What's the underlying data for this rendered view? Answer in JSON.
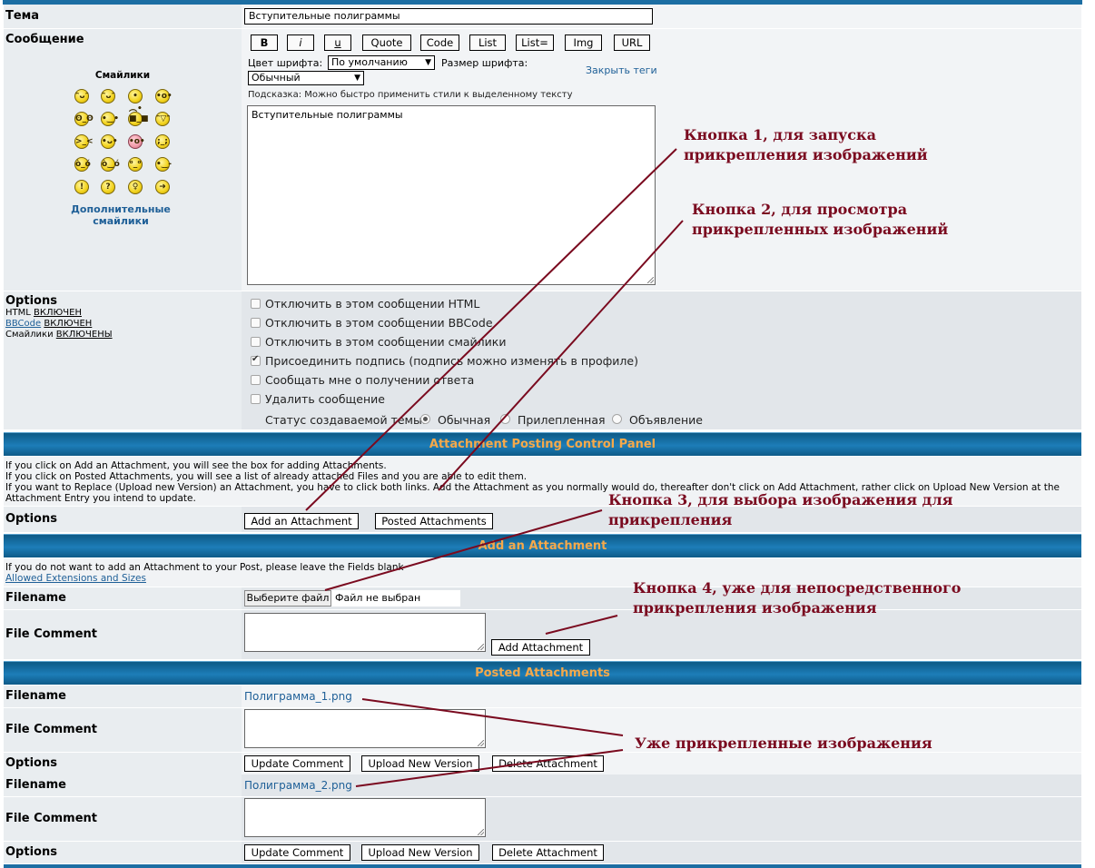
{
  "form": {
    "subject_label": "Тема",
    "subject_value": "Вступительные полиграммы",
    "message_label": "Сообщение",
    "smilies_title": "Смайлики",
    "more_smilies": "Дополнительные смайлики",
    "bbcode_buttons": [
      "B",
      "i",
      "u",
      "Quote",
      "Code",
      "List",
      "List=",
      "Img",
      "URL"
    ],
    "font_color_label": "Цвет шрифта:",
    "font_color_value": "По умолчанию",
    "font_size_label": "Размер шрифта:",
    "font_size_value": "Обычный",
    "close_tags": "Закрыть теги",
    "hint": "Подсказка: Можно быстро применить стили к выделенному тексту",
    "message_text": "Вступительные полиграммы"
  },
  "options": {
    "label": "Options",
    "html_line": {
      "name": "HTML",
      "state": "ВКЛЮЧЕН"
    },
    "bbcode_line": {
      "name": "BBCode",
      "state": "ВКЛЮЧЕН"
    },
    "smilies_line": {
      "name": "Смайлики",
      "state": "ВКЛЮЧЕНЫ"
    },
    "checkboxes": [
      {
        "label": "Отключить в этом сообщении HTML",
        "checked": false
      },
      {
        "label": "Отключить в этом сообщении BBCode",
        "checked": false
      },
      {
        "label": "Отключить в этом сообщении смайлики",
        "checked": false
      },
      {
        "label": "Присоединить подпись (подпись можно изменять в профиле)",
        "checked": true
      },
      {
        "label": "Сообщать мне о получении ответа",
        "checked": false
      },
      {
        "label": "Удалить сообщение",
        "checked": false
      }
    ],
    "topic_status_label": "Статус создаваемой темы:",
    "topic_status_options": [
      {
        "label": "Обычная",
        "selected": true
      },
      {
        "label": "Прилепленная",
        "selected": false
      },
      {
        "label": "Объявление",
        "selected": false
      }
    ]
  },
  "attach_panel": {
    "title": "Attachment Posting Control Panel",
    "lines": [
      "If you click on Add an Attachment, you will see the box for adding Attachments.",
      "If you click on Posted Attachments, you will see a list of already attached Files and you are able to edit them.",
      "If you want to Replace (Upload new Version) an Attachment, you have to click both links. Add the Attachment as you normally would do, thereafter don't click on Add Attachment, rather click on Upload New Version at the Attachment Entry you intend to update."
    ],
    "options_label": "Options",
    "add_button": "Add an Attachment",
    "posted_button": "Posted Attachments"
  },
  "add_attachment": {
    "title": "Add an Attachment",
    "note": "If you do not want to add an Attachment to your Post, please leave the Fields blank",
    "extensions_link": "Allowed Extensions and Sizes",
    "filename_label": "Filename",
    "choose_button": "Выберите файл",
    "no_file": "Файл не выбран",
    "comment_label": "File Comment",
    "submit_button": "Add Attachment"
  },
  "posted": {
    "title": "Posted Attachments",
    "items": [
      {
        "filename_label": "Filename",
        "filename": "Полиграмма_1.png",
        "comment_label": "File Comment",
        "options_label": "Options",
        "update": "Update Comment",
        "upload": "Upload New Version",
        "delete": "Delete Attachment"
      },
      {
        "filename_label": "Filename",
        "filename": "Полиграмма_2.png",
        "comment_label": "File Comment",
        "options_label": "Options",
        "update": "Update Comment",
        "upload": "Upload New Version",
        "delete": "Delete Attachment"
      }
    ]
  },
  "annotations": {
    "a1": [
      "Кнопка 1, для запуска",
      "прикрепления изображений"
    ],
    "a2": [
      "Кнопка 2, для просмотра",
      "прикрепленных изображений"
    ],
    "a3": [
      "Кнопка 3, для выбора изображения для",
      "прикрепления"
    ],
    "a4": [
      "Кнопка 4, уже для непосредственного",
      "прикрепления изображения"
    ],
    "a5": "Уже прикрепленные изображения",
    "color": "#7a0a1f"
  }
}
